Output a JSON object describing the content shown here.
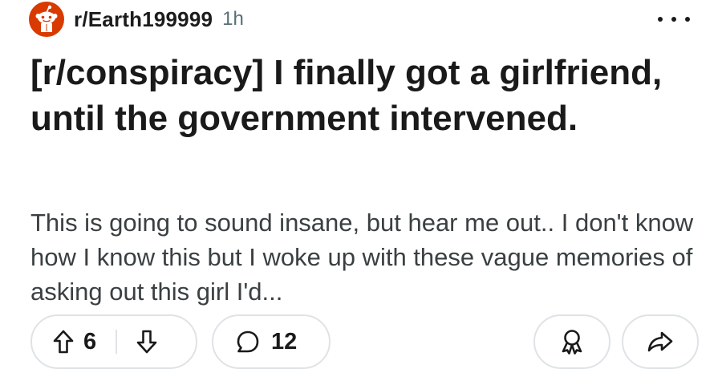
{
  "header": {
    "subreddit": "r/Earth199999",
    "time": "1h"
  },
  "post": {
    "title": "[r/conspiracy] I finally got a girlfriend, until the government intervened.",
    "preview": "This is going to sound insane, but hear me out.. I don't know how I know this but I woke up with these vague memories of asking out this girl I'd..."
  },
  "actions": {
    "votes": "6",
    "comments": "12"
  },
  "icons": {
    "avatar": "reddit-snoo-icon",
    "more": "more-horizontal-icon",
    "upvote": "arrow-up-icon",
    "downvote": "arrow-down-icon",
    "comment": "comment-bubble-icon",
    "award": "award-icon",
    "share": "share-arrow-icon"
  },
  "colors": {
    "avatar_bg": "#d93a00",
    "text": "#1a1a1b",
    "muted": "#576f76",
    "border": "#dfe3e6"
  }
}
